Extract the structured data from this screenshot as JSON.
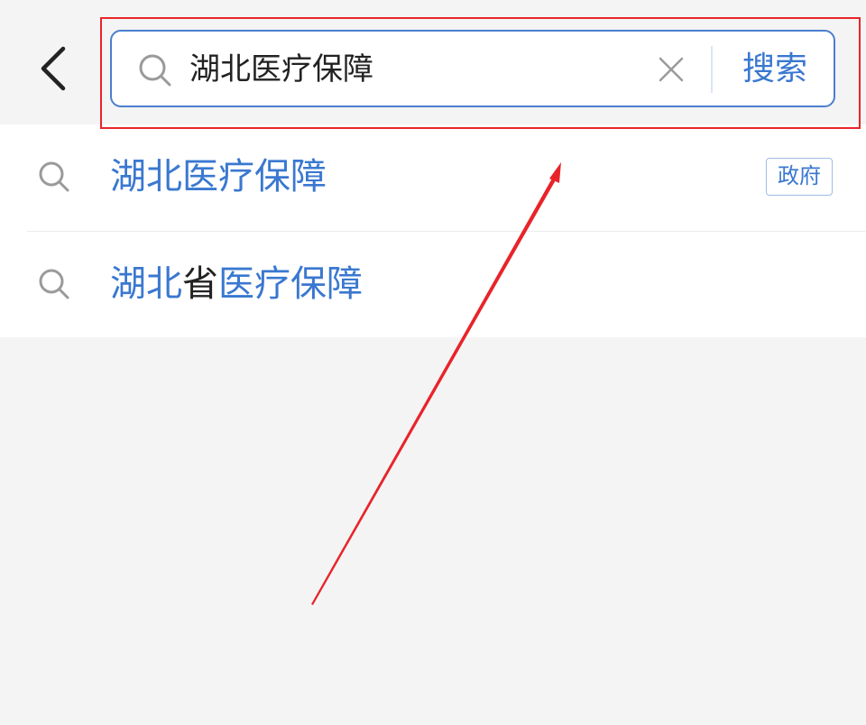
{
  "header": {
    "back_icon": "chevron-left-icon",
    "search": {
      "icon": "search-icon",
      "value": "湖北医疗保障",
      "placeholder": "",
      "clear_icon": "close-icon",
      "submit_label": "搜索"
    }
  },
  "suggestions": [
    {
      "icon": "search-icon",
      "parts": [
        {
          "text": "湖北医疗保障",
          "highlight": true
        }
      ],
      "badge": "政府"
    },
    {
      "icon": "search-icon",
      "parts": [
        {
          "text": "湖北",
          "highlight": true
        },
        {
          "text": "省",
          "highlight": false
        },
        {
          "text": "医疗保障",
          "highlight": true
        }
      ],
      "badge": null
    }
  ],
  "colors": {
    "accent": "#3a78d0",
    "search_border": "#4a7fcf",
    "annotation_red": "#e8242a",
    "background": "#f4f4f4",
    "text_primary": "#222222",
    "icon_gray": "#9a9a9a"
  }
}
